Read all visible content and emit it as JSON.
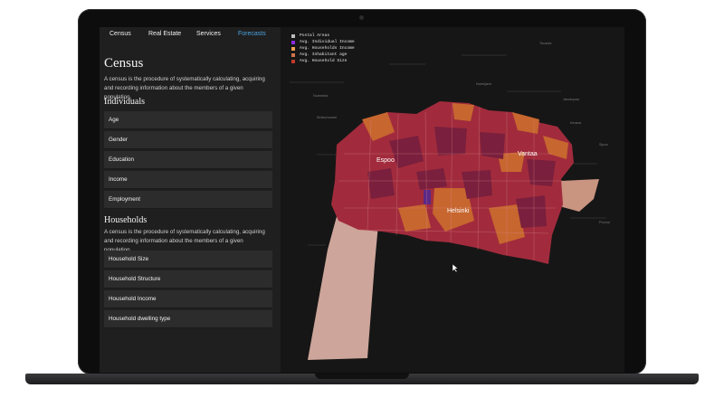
{
  "nav": {
    "tabs": [
      {
        "label": "Census"
      },
      {
        "label": "Real Estate"
      },
      {
        "label": "Services"
      },
      {
        "label": "Forecasts"
      }
    ],
    "active": "Forecasts"
  },
  "census": {
    "title": "Census",
    "description": "A census is the procedure of systematically calculating, acquiring and recording information about the members of a given population."
  },
  "individuals": {
    "title": "Individuals",
    "items": [
      "Age",
      "Gender",
      "Education",
      "Income",
      "Employment"
    ]
  },
  "households": {
    "title": "Households",
    "description": "A census is the procedure of systematically calculating, acquiring and recording information about the members of a given population.",
    "items": [
      "Household Size",
      "Household Structure",
      "Household Income",
      "Household dwelling type"
    ]
  },
  "map": {
    "legend": [
      {
        "label": "Postal Areas",
        "color": "#bdbdbd"
      },
      {
        "label": "Avg. Individual Income",
        "color": "#8a2be2"
      },
      {
        "label": "Avg. Households Income",
        "color": "#f0a050"
      },
      {
        "label": "Avg. Inhabitant age",
        "color": "#d2734a"
      },
      {
        "label": "Avg. Household Size",
        "color": "#c0392b"
      }
    ],
    "cities": {
      "espoo": "Espoo",
      "helsinki": "Helsinki",
      "vantaa": "Vantaa"
    },
    "places": [
      "Nummela",
      "Nurmijarvi",
      "Jarvenpaa",
      "Tuusula",
      "Kerava",
      "Sipoo",
      "Kirkkonummi",
      "Porvoo"
    ],
    "colors": {
      "dark": "#7a1f3d",
      "mid": "#a12b3c",
      "orange": "#c7662f",
      "pale": "#cda59a"
    }
  }
}
